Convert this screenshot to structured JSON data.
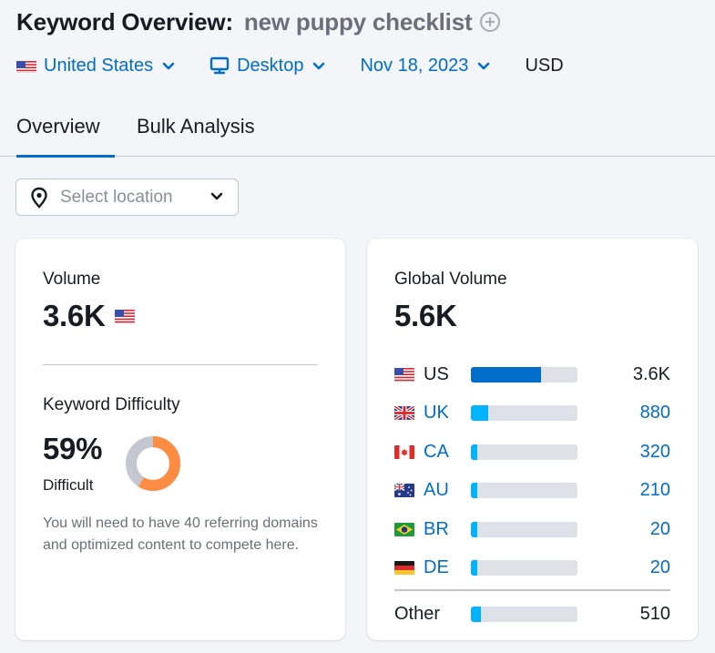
{
  "header": {
    "title": "Keyword Overview:",
    "keyword": "new puppy checklist",
    "add_icon": "plus-circle-icon"
  },
  "filters": {
    "country": "United States",
    "device": "Desktop",
    "date": "Nov 18, 2023",
    "currency": "USD"
  },
  "tabs": [
    {
      "label": "Overview",
      "active": true
    },
    {
      "label": "Bulk Analysis",
      "active": false
    }
  ],
  "location_select": {
    "placeholder": "Select location",
    "icon": "map-pin-icon"
  },
  "volume_card": {
    "label": "Volume",
    "value": "3.6K",
    "country_flag": "US",
    "kd_label": "Keyword Difficulty",
    "kd_value": "59%",
    "kd_percent": 59,
    "kd_level": "Difficult",
    "kd_description": "You will need to have 40 referring domains and optimized content to compete here.",
    "colors": {
      "kd_fill": "#ff8c43",
      "kd_track": "#c4c7cf"
    }
  },
  "global_card": {
    "label": "Global Volume",
    "value": "5.6K",
    "countries": [
      {
        "code": "US",
        "value": "3.6K",
        "share": 0.66,
        "link": false,
        "color": "#006dca"
      },
      {
        "code": "UK",
        "value": "880",
        "share": 0.16,
        "link": true,
        "color": "#00b3ff"
      },
      {
        "code": "CA",
        "value": "320",
        "share": 0.06,
        "link": true,
        "color": "#00b3ff"
      },
      {
        "code": "AU",
        "value": "210",
        "share": 0.04,
        "link": true,
        "color": "#00b3ff"
      },
      {
        "code": "BR",
        "value": "20",
        "share": 0.01,
        "link": true,
        "color": "#00b3ff"
      },
      {
        "code": "DE",
        "value": "20",
        "share": 0.01,
        "link": true,
        "color": "#00b3ff"
      }
    ],
    "other": {
      "label": "Other",
      "value": "510",
      "share": 0.09,
      "color": "#00b3ff"
    }
  }
}
